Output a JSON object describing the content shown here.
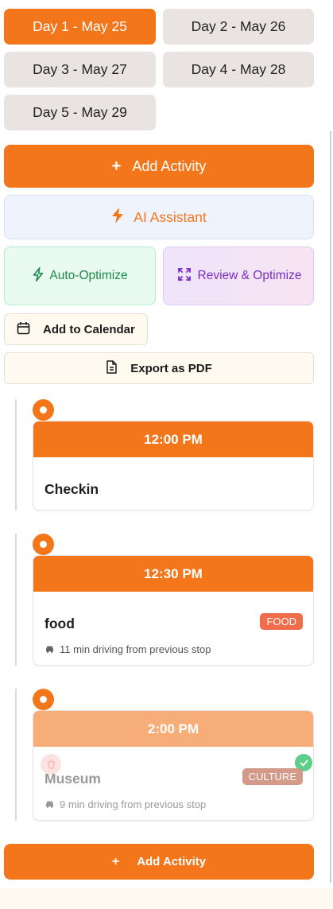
{
  "days": [
    {
      "label": "Day 1 - May 25",
      "active": true
    },
    {
      "label": "Day 2 - May 26",
      "active": false
    },
    {
      "label": "Day 3 - May 27",
      "active": false
    },
    {
      "label": "Day 4 - May 28",
      "active": false
    },
    {
      "label": "Day 5 - May 29",
      "active": false
    }
  ],
  "actions": {
    "add_activity_icon": "+",
    "add_activity": "Add Activity",
    "ai_assistant": "AI Assistant",
    "auto_optimize": "Auto-Optimize",
    "review_optimize": "Review & Optimize",
    "add_to_calendar": "Add to Calendar",
    "export_pdf": "Export as PDF"
  },
  "timeline": [
    {
      "time": "12:00 PM",
      "title": "Checkin",
      "badge": "",
      "drive": "",
      "completed": false
    },
    {
      "time": "12:30 PM",
      "title": "food",
      "badge": "FOOD",
      "drive": "11 min driving from previous stop",
      "completed": false
    },
    {
      "time": "2:00 PM",
      "title": "Museum",
      "badge": "CULTURE",
      "drive": "9 min driving from previous stop",
      "completed": true
    }
  ],
  "footer": {
    "add_activity_icon": "+",
    "add_activity": "Add Activity"
  },
  "colors": {
    "accent": "#f3761b",
    "food": "#f06c4a",
    "culture": "#d49a89",
    "success": "#5ccf8a"
  },
  "icons": [
    "plus-icon",
    "lightning-icon",
    "expand-icon",
    "calendar-icon",
    "document-icon",
    "car-icon",
    "trash-icon",
    "check-icon"
  ]
}
